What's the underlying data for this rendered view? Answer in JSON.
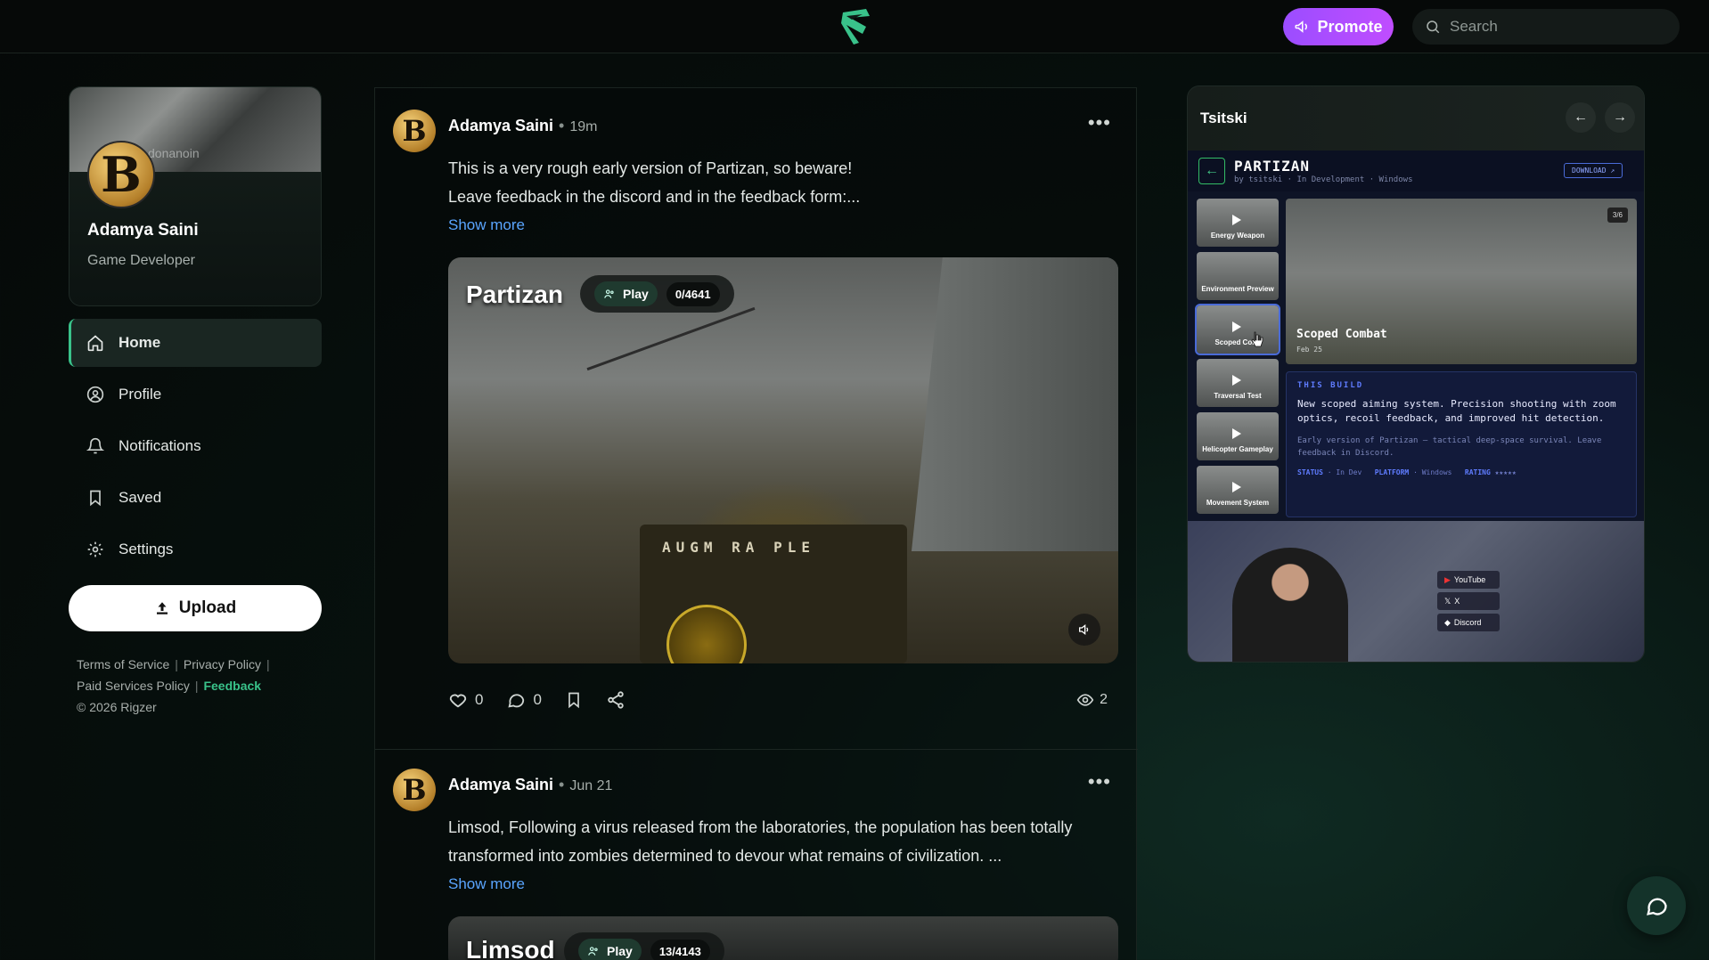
{
  "topbar": {
    "promote_label": "Promote",
    "search_placeholder": "Search",
    "logo_icon": "rigzer-logo"
  },
  "profile": {
    "name": "Adamya Saini",
    "role": "Game Developer",
    "banner_text": "donanoin"
  },
  "nav": {
    "items": [
      {
        "label": "Home",
        "icon": "home-icon",
        "active": true
      },
      {
        "label": "Profile",
        "icon": "user-circle-icon"
      },
      {
        "label": "Notifications",
        "icon": "bell-icon"
      },
      {
        "label": "Saved",
        "icon": "bookmark-icon"
      },
      {
        "label": "Settings",
        "icon": "gear-icon"
      }
    ],
    "upload_label": "Upload"
  },
  "footer": {
    "terms": "Terms of Service",
    "privacy": "Privacy Policy",
    "paid": "Paid Services Policy",
    "feedback": "Feedback",
    "copyright": "© 2026 Rigzer"
  },
  "posts": [
    {
      "author": "Adamya Saini",
      "time": "19m",
      "line1": "This is a very rough early version of Partizan, so beware!",
      "line2": "Leave feedback in the discord and in the feedback form:...",
      "show_more": "Show more",
      "game_title": "Partizan",
      "play_label": "Play",
      "play_count": "0/4641",
      "hud_text": "AUGM RA PLE",
      "likes": "0",
      "comments": "0",
      "views": "2"
    },
    {
      "author": "Adamya Saini",
      "time": "Jun 21",
      "line1": "Limsod, Following a virus released from the laboratories, the population has been totally",
      "line2": "transformed into zombies determined to devour what remains of civilization. ...",
      "show_more": "Show more",
      "game_title": "Limsod",
      "play_label": "Play",
      "play_count": "13/4143"
    }
  ],
  "right_panel": {
    "title": "Tsitski",
    "game": "PARTIZAN",
    "byline": "by tsitski · In Development · Windows",
    "download": "DOWNLOAD ↗",
    "thumbs": [
      "Energy Weapon",
      "Environment Preview",
      "Scoped Cor...",
      "Traversal Test",
      "Helicopter Gameplay",
      "Movement System"
    ],
    "main_label": "Scoped Combat",
    "main_date": "Feb 25",
    "page": "3/6",
    "build_heading": "THIS BUILD",
    "build_text": "New scoped aiming system. Precision shooting with zoom optics, recoil feedback, and improved hit detection.",
    "build_sub": "Early version of Partizan — tactical deep-space survival. Leave feedback in Discord.",
    "meta_status_k": "STATUS",
    "meta_status_v": "In Dev",
    "meta_platform_k": "PLATFORM",
    "meta_platform_v": "Windows",
    "meta_rating_k": "RATING",
    "meta_rating_v": "★★★★★",
    "socials": [
      "YouTube",
      "X",
      "Discord"
    ]
  }
}
